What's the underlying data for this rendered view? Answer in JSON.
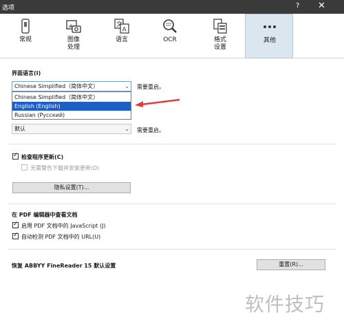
{
  "window": {
    "title": "选项",
    "help_label": "?",
    "close_label": "✕"
  },
  "tabs": [
    {
      "label": "常规",
      "icon": "phone-icon"
    },
    {
      "label": "图像\n处理",
      "icon": "image-camera-icon"
    },
    {
      "label": "语言",
      "icon": "language-icon"
    },
    {
      "label": "OCR",
      "icon": "magnifier-icon"
    },
    {
      "label": "格式\n设置",
      "icon": "format-icon"
    },
    {
      "label": "其他",
      "icon": "more-icon",
      "active": true
    }
  ],
  "ui_language": {
    "label": "界面语言(I)",
    "selected": "Chinese Simplified（简体中文）",
    "restart_note": "需要重启。",
    "options": [
      "Chinese Simplified（简体中文）",
      "English (English)",
      "Russian (Русский)"
    ],
    "highlighted_option": "English (English)"
  },
  "second_combo": {
    "selected": "默认",
    "restart_note": "需要重启。"
  },
  "updates": {
    "check_label": "检查程序更新(C)",
    "no_warn_label": "无需警告下载并安装更新(D)",
    "privacy_button": "隐私设置(T)..."
  },
  "pdf_editor": {
    "title": "在 PDF 编辑器中查看文档",
    "js_label": "启用 PDF 文档中的 JavaScript (J)",
    "url_label": "自动检测 PDF 文档中的 URL(U)"
  },
  "restore": {
    "label": "恢复 ABBYY FineReader 15 默认设置",
    "button": "重置(R)..."
  },
  "watermark": "软件技巧",
  "colors": {
    "titlebar": "#3a3a3a",
    "highlight": "#1e5fc6",
    "arrow": "#e23b3b"
  }
}
